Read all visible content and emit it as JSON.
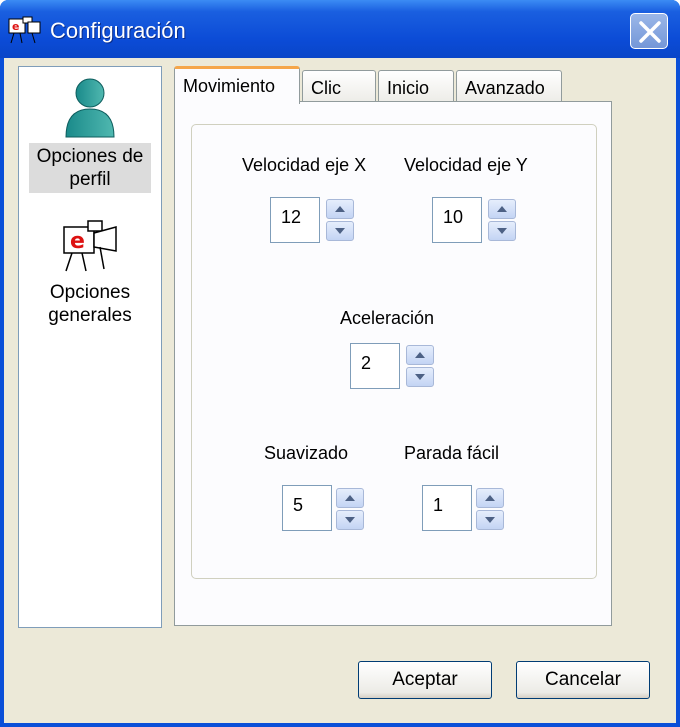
{
  "window": {
    "title": "Configuración",
    "close_icon": "close-icon"
  },
  "sidebar": {
    "items": [
      {
        "label": "Opciones de perfil",
        "line1": "Opciones de",
        "line2": "perfil",
        "icon": "user-profile-icon",
        "selected": true
      },
      {
        "label": "Opciones generales",
        "line1": "Opciones",
        "line2": "generales",
        "icon": "camera-logo-icon",
        "selected": false
      }
    ]
  },
  "tabs": [
    {
      "label": "Movimiento",
      "active": true
    },
    {
      "label": "Clic",
      "active": false
    },
    {
      "label": "Inicio",
      "active": false
    },
    {
      "label": "Avanzado",
      "active": false
    }
  ],
  "movement": {
    "speed_x": {
      "label": "Velocidad eje X",
      "value": "12"
    },
    "speed_y": {
      "label": "Velocidad eje Y",
      "value": "10"
    },
    "acceleration": {
      "label": "Aceleración",
      "value": "2"
    },
    "smoothing": {
      "label": "Suavizado",
      "value": "5"
    },
    "easy_stop": {
      "label": "Parada fácil",
      "value": "1"
    }
  },
  "buttons": {
    "accept": "Aceptar",
    "cancel": "Cancelar"
  }
}
